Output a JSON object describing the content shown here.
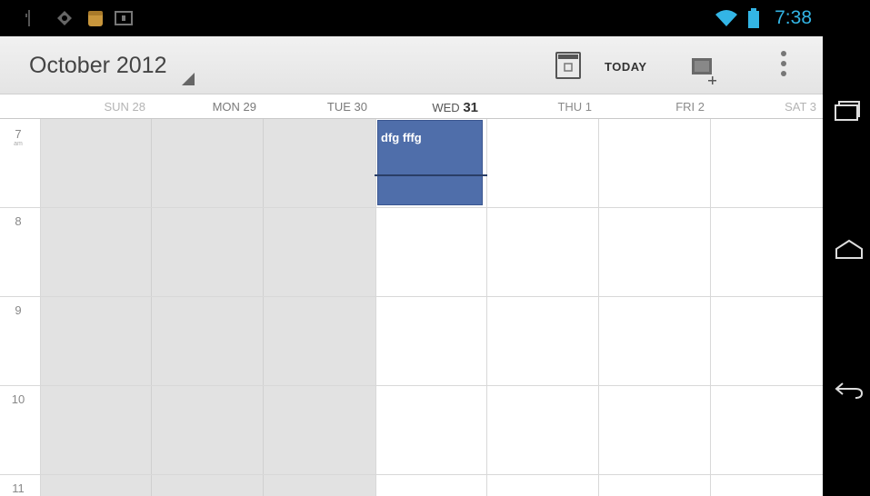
{
  "status_bar": {
    "time": "7:38",
    "icons": [
      "usb-icon",
      "gps-icon",
      "notification-app-icon",
      "screenshot-icon",
      "wifi-icon",
      "battery-icon"
    ]
  },
  "action_bar": {
    "month_title": "October 2012",
    "today_label": "TODAY",
    "icons": [
      "go-to-today-icon",
      "new-event-icon",
      "overflow-menu-icon"
    ]
  },
  "day_header": {
    "days": [
      {
        "label": "SUN 28",
        "state": "past"
      },
      {
        "label": "MON 29",
        "state": "past"
      },
      {
        "label": "TUE 30",
        "state": "past"
      },
      {
        "label": "WED ",
        "num": "31",
        "state": "today"
      },
      {
        "label": "THU 1",
        "state": "future"
      },
      {
        "label": "FRI 2",
        "state": "future"
      },
      {
        "label": "SAT 3",
        "state": "future"
      }
    ]
  },
  "grid": {
    "hours": [
      {
        "hour": "7",
        "suffix": "am"
      },
      {
        "hour": "8",
        "suffix": ""
      },
      {
        "hour": "9",
        "suffix": ""
      },
      {
        "hour": "10",
        "suffix": ""
      },
      {
        "hour": "11",
        "suffix": ""
      }
    ]
  },
  "event": {
    "title": "dfg fffg",
    "color": "#4f6eaa"
  },
  "navigation_bar": {
    "icons": [
      "recent-apps-icon",
      "home-icon",
      "back-icon"
    ]
  }
}
